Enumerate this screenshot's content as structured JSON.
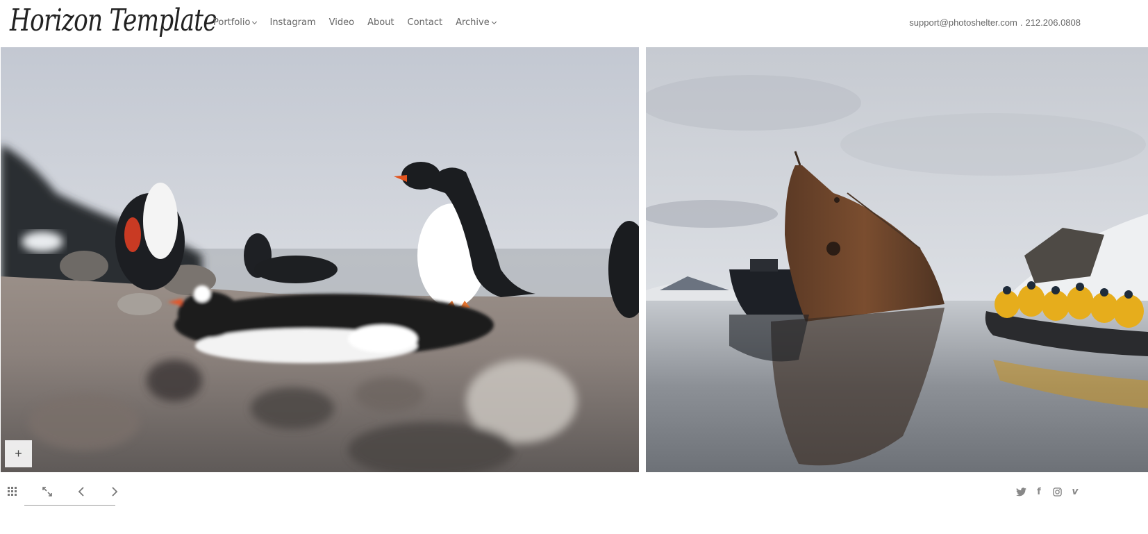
{
  "header": {
    "logo_text": "Horizon Template",
    "nav": [
      {
        "label": "Portfolio",
        "dropdown": true
      },
      {
        "label": "Instagram",
        "dropdown": false
      },
      {
        "label": "Video",
        "dropdown": false
      },
      {
        "label": "About",
        "dropdown": false
      },
      {
        "label": "Contact",
        "dropdown": false
      },
      {
        "label": "Archive",
        "dropdown": true
      }
    ],
    "email": "support@photoshelter.com",
    "separator": ".",
    "phone": "212.206.0808"
  },
  "gallery": {
    "images": [
      {
        "subject": "gentoo penguins on rocky shore"
      },
      {
        "subject": "rusted shipwreck with zodiac boat"
      }
    ],
    "info_button": "+"
  },
  "controls": {
    "icons": [
      "grid-icon",
      "fullscreen-icon",
      "prev-arrow-icon",
      "next-arrow-icon"
    ]
  },
  "social": {
    "icons": [
      "twitter-icon",
      "facebook-icon",
      "instagram-icon",
      "vimeo-icon"
    ],
    "facebook_glyph": "f",
    "vimeo_glyph": "v"
  },
  "colors": {
    "nav_text": "#666666",
    "logo_text": "#222222",
    "icon": "#777777"
  }
}
